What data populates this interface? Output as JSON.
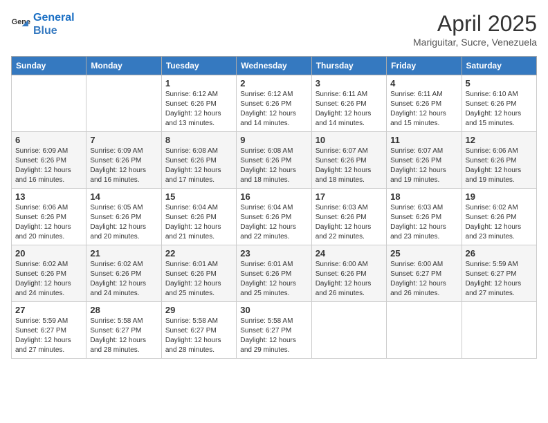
{
  "logo": {
    "line1": "General",
    "line2": "Blue"
  },
  "title": "April 2025",
  "subtitle": "Mariguitar, Sucre, Venezuela",
  "headers": [
    "Sunday",
    "Monday",
    "Tuesday",
    "Wednesday",
    "Thursday",
    "Friday",
    "Saturday"
  ],
  "weeks": [
    [
      {
        "day": "",
        "info": ""
      },
      {
        "day": "",
        "info": ""
      },
      {
        "day": "1",
        "info": "Sunrise: 6:12 AM\nSunset: 6:26 PM\nDaylight: 12 hours and 13 minutes."
      },
      {
        "day": "2",
        "info": "Sunrise: 6:12 AM\nSunset: 6:26 PM\nDaylight: 12 hours and 14 minutes."
      },
      {
        "day": "3",
        "info": "Sunrise: 6:11 AM\nSunset: 6:26 PM\nDaylight: 12 hours and 14 minutes."
      },
      {
        "day": "4",
        "info": "Sunrise: 6:11 AM\nSunset: 6:26 PM\nDaylight: 12 hours and 15 minutes."
      },
      {
        "day": "5",
        "info": "Sunrise: 6:10 AM\nSunset: 6:26 PM\nDaylight: 12 hours and 15 minutes."
      }
    ],
    [
      {
        "day": "6",
        "info": "Sunrise: 6:09 AM\nSunset: 6:26 PM\nDaylight: 12 hours and 16 minutes."
      },
      {
        "day": "7",
        "info": "Sunrise: 6:09 AM\nSunset: 6:26 PM\nDaylight: 12 hours and 16 minutes."
      },
      {
        "day": "8",
        "info": "Sunrise: 6:08 AM\nSunset: 6:26 PM\nDaylight: 12 hours and 17 minutes."
      },
      {
        "day": "9",
        "info": "Sunrise: 6:08 AM\nSunset: 6:26 PM\nDaylight: 12 hours and 18 minutes."
      },
      {
        "day": "10",
        "info": "Sunrise: 6:07 AM\nSunset: 6:26 PM\nDaylight: 12 hours and 18 minutes."
      },
      {
        "day": "11",
        "info": "Sunrise: 6:07 AM\nSunset: 6:26 PM\nDaylight: 12 hours and 19 minutes."
      },
      {
        "day": "12",
        "info": "Sunrise: 6:06 AM\nSunset: 6:26 PM\nDaylight: 12 hours and 19 minutes."
      }
    ],
    [
      {
        "day": "13",
        "info": "Sunrise: 6:06 AM\nSunset: 6:26 PM\nDaylight: 12 hours and 20 minutes."
      },
      {
        "day": "14",
        "info": "Sunrise: 6:05 AM\nSunset: 6:26 PM\nDaylight: 12 hours and 20 minutes."
      },
      {
        "day": "15",
        "info": "Sunrise: 6:04 AM\nSunset: 6:26 PM\nDaylight: 12 hours and 21 minutes."
      },
      {
        "day": "16",
        "info": "Sunrise: 6:04 AM\nSunset: 6:26 PM\nDaylight: 12 hours and 22 minutes."
      },
      {
        "day": "17",
        "info": "Sunrise: 6:03 AM\nSunset: 6:26 PM\nDaylight: 12 hours and 22 minutes."
      },
      {
        "day": "18",
        "info": "Sunrise: 6:03 AM\nSunset: 6:26 PM\nDaylight: 12 hours and 23 minutes."
      },
      {
        "day": "19",
        "info": "Sunrise: 6:02 AM\nSunset: 6:26 PM\nDaylight: 12 hours and 23 minutes."
      }
    ],
    [
      {
        "day": "20",
        "info": "Sunrise: 6:02 AM\nSunset: 6:26 PM\nDaylight: 12 hours and 24 minutes."
      },
      {
        "day": "21",
        "info": "Sunrise: 6:02 AM\nSunset: 6:26 PM\nDaylight: 12 hours and 24 minutes."
      },
      {
        "day": "22",
        "info": "Sunrise: 6:01 AM\nSunset: 6:26 PM\nDaylight: 12 hours and 25 minutes."
      },
      {
        "day": "23",
        "info": "Sunrise: 6:01 AM\nSunset: 6:26 PM\nDaylight: 12 hours and 25 minutes."
      },
      {
        "day": "24",
        "info": "Sunrise: 6:00 AM\nSunset: 6:26 PM\nDaylight: 12 hours and 26 minutes."
      },
      {
        "day": "25",
        "info": "Sunrise: 6:00 AM\nSunset: 6:27 PM\nDaylight: 12 hours and 26 minutes."
      },
      {
        "day": "26",
        "info": "Sunrise: 5:59 AM\nSunset: 6:27 PM\nDaylight: 12 hours and 27 minutes."
      }
    ],
    [
      {
        "day": "27",
        "info": "Sunrise: 5:59 AM\nSunset: 6:27 PM\nDaylight: 12 hours and 27 minutes."
      },
      {
        "day": "28",
        "info": "Sunrise: 5:58 AM\nSunset: 6:27 PM\nDaylight: 12 hours and 28 minutes."
      },
      {
        "day": "29",
        "info": "Sunrise: 5:58 AM\nSunset: 6:27 PM\nDaylight: 12 hours and 28 minutes."
      },
      {
        "day": "30",
        "info": "Sunrise: 5:58 AM\nSunset: 6:27 PM\nDaylight: 12 hours and 29 minutes."
      },
      {
        "day": "",
        "info": ""
      },
      {
        "day": "",
        "info": ""
      },
      {
        "day": "",
        "info": ""
      }
    ]
  ]
}
